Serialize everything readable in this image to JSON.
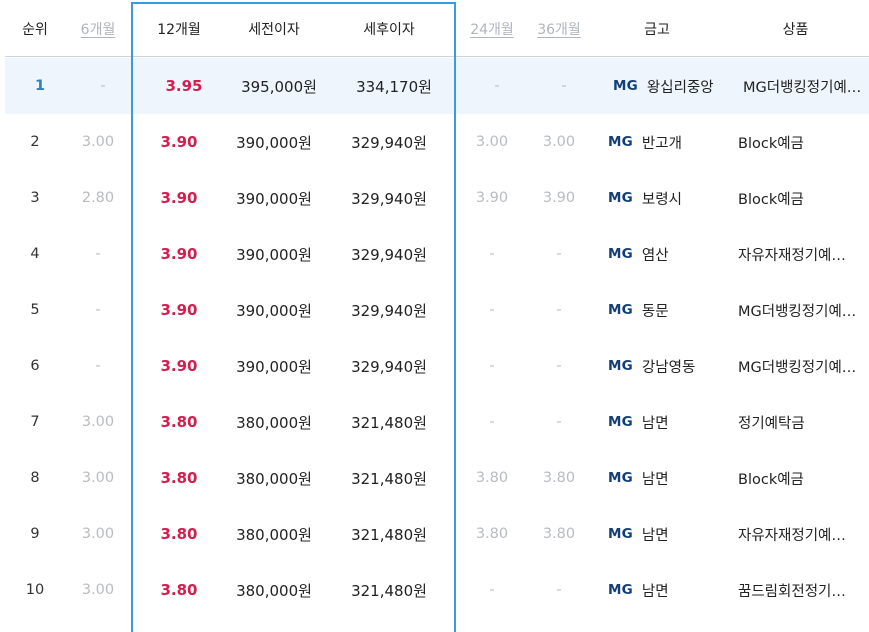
{
  "header": {
    "rank": "순위",
    "m6": "6개월",
    "m12": "12개월",
    "pre_tax": "세전이자",
    "post_tax": "세후이자",
    "m24": "24개월",
    "m36": "36개월",
    "bank": "금고",
    "product": "상품"
  },
  "colors": {
    "highlight_border": "#3a9be0",
    "rate_red": "#d21f4f",
    "rank_blue": "#2f7fc1",
    "logo_navy": "#123f7a",
    "selected_row_bg": "#eef5fc"
  },
  "rows": [
    {
      "rank": "1",
      "m6": "-",
      "m12": "3.95",
      "pre_tax": "395,000원",
      "post_tax": "334,170원",
      "m24": "-",
      "m36": "-",
      "logo": "MG",
      "bank": "왕십리중앙",
      "product": "MG더뱅킹정기예…"
    },
    {
      "rank": "2",
      "m6": "3.00",
      "m12": "3.90",
      "pre_tax": "390,000원",
      "post_tax": "329,940원",
      "m24": "3.00",
      "m36": "3.00",
      "logo": "MG",
      "bank": "반고개",
      "product": "Block예금"
    },
    {
      "rank": "3",
      "m6": "2.80",
      "m12": "3.90",
      "pre_tax": "390,000원",
      "post_tax": "329,940원",
      "m24": "3.90",
      "m36": "3.90",
      "logo": "MG",
      "bank": "보령시",
      "product": "Block예금"
    },
    {
      "rank": "4",
      "m6": "-",
      "m12": "3.90",
      "pre_tax": "390,000원",
      "post_tax": "329,940원",
      "m24": "-",
      "m36": "-",
      "logo": "MG",
      "bank": "염산",
      "product": "자유자재정기예…"
    },
    {
      "rank": "5",
      "m6": "-",
      "m12": "3.90",
      "pre_tax": "390,000원",
      "post_tax": "329,940원",
      "m24": "-",
      "m36": "-",
      "logo": "MG",
      "bank": "동문",
      "product": "MG더뱅킹정기예…"
    },
    {
      "rank": "6",
      "m6": "-",
      "m12": "3.90",
      "pre_tax": "390,000원",
      "post_tax": "329,940원",
      "m24": "-",
      "m36": "-",
      "logo": "MG",
      "bank": "강남영동",
      "product": "MG더뱅킹정기예…"
    },
    {
      "rank": "7",
      "m6": "3.00",
      "m12": "3.80",
      "pre_tax": "380,000원",
      "post_tax": "321,480원",
      "m24": "-",
      "m36": "-",
      "logo": "MG",
      "bank": "남면",
      "product": "정기예탁금"
    },
    {
      "rank": "8",
      "m6": "3.00",
      "m12": "3.80",
      "pre_tax": "380,000원",
      "post_tax": "321,480원",
      "m24": "3.80",
      "m36": "3.80",
      "logo": "MG",
      "bank": "남면",
      "product": "Block예금"
    },
    {
      "rank": "9",
      "m6": "3.00",
      "m12": "3.80",
      "pre_tax": "380,000원",
      "post_tax": "321,480원",
      "m24": "3.80",
      "m36": "3.80",
      "logo": "MG",
      "bank": "남면",
      "product": "자유자재정기예…"
    },
    {
      "rank": "10",
      "m6": "3.00",
      "m12": "3.80",
      "pre_tax": "380,000원",
      "post_tax": "321,480원",
      "m24": "-",
      "m36": "-",
      "logo": "MG",
      "bank": "남면",
      "product": "꿈드림회전정기…"
    }
  ]
}
